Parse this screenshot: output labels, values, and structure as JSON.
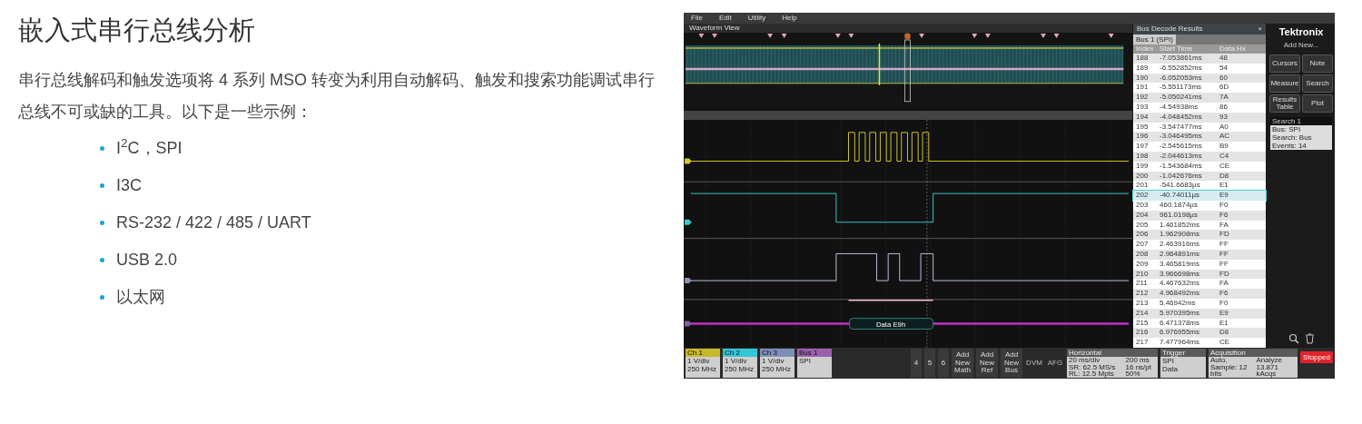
{
  "article": {
    "title": "嵌入式串行总线分析",
    "intro": "串行总线解码和触发选项将 4 系列 MSO 转变为利用自动解码、触发和搜索功能调试串行总线不可或缺的工具。以下是一些示例：",
    "items": [
      "I$^{2}$C，SPI",
      "I3C",
      "RS-232 / 422 / 485 / UART",
      "USB 2.0",
      "以太网"
    ]
  },
  "scope": {
    "menu": [
      "File",
      "Edit",
      "Utility",
      "Help"
    ],
    "waveform_view": {
      "title": "Waveform View",
      "decode_label": "Data E9h"
    },
    "results": {
      "title": "Bus Decode Results",
      "close": "×",
      "tab": "Bus 1 (SPI)",
      "columns": [
        "Index",
        "Start Time",
        "Data Hx"
      ],
      "rows": [
        {
          "index": "188",
          "start_time": "-7.053861ms",
          "data": "48",
          "selected": false
        },
        {
          "index": "189",
          "start_time": "-6.552852ms",
          "data": "54",
          "selected": false
        },
        {
          "index": "190",
          "start_time": "-6.052053ms",
          "data": "60",
          "selected": false
        },
        {
          "index": "191",
          "start_time": "-5.551173ms",
          "data": "6D",
          "selected": false
        },
        {
          "index": "192",
          "start_time": "-5.050241ms",
          "data": "7A",
          "selected": false
        },
        {
          "index": "193",
          "start_time": "-4.54938ms",
          "data": "86",
          "selected": false
        },
        {
          "index": "194",
          "start_time": "-4.048452ms",
          "data": "93",
          "selected": false
        },
        {
          "index": "195",
          "start_time": "-3.547477ms",
          "data": "A0",
          "selected": false
        },
        {
          "index": "196",
          "start_time": "-3.046495ms",
          "data": "AC",
          "selected": false
        },
        {
          "index": "197",
          "start_time": "-2.545615ms",
          "data": "B9",
          "selected": false
        },
        {
          "index": "198",
          "start_time": "-2.044613ms",
          "data": "C4",
          "selected": false
        },
        {
          "index": "199",
          "start_time": "-1.543684ms",
          "data": "CE",
          "selected": false
        },
        {
          "index": "200",
          "start_time": "-1.042676ms",
          "data": "D8",
          "selected": false
        },
        {
          "index": "201",
          "start_time": "-541.6683µs",
          "data": "E1",
          "selected": false
        },
        {
          "index": "202",
          "start_time": "-40.74011µs",
          "data": "E9",
          "selected": true
        },
        {
          "index": "203",
          "start_time": "460.1874µs",
          "data": "F0",
          "selected": false
        },
        {
          "index": "204",
          "start_time": "961.0198µs",
          "data": "F6",
          "selected": false
        },
        {
          "index": "205",
          "start_time": "1.461852ms",
          "data": "FA",
          "selected": false
        },
        {
          "index": "206",
          "start_time": "1.962908ms",
          "data": "FD",
          "selected": false
        },
        {
          "index": "207",
          "start_time": "2.463916ms",
          "data": "FF",
          "selected": false
        },
        {
          "index": "208",
          "start_time": "2.964891ms",
          "data": "FF",
          "selected": false
        },
        {
          "index": "209",
          "start_time": "3.465819ms",
          "data": "FF",
          "selected": false
        },
        {
          "index": "210",
          "start_time": "3.966698ms",
          "data": "FD",
          "selected": false
        },
        {
          "index": "211",
          "start_time": "4.467632ms",
          "data": "FA",
          "selected": false
        },
        {
          "index": "212",
          "start_time": "4.968492ms",
          "data": "F6",
          "selected": false
        },
        {
          "index": "213",
          "start_time": "5.46942ms",
          "data": "F0",
          "selected": false
        },
        {
          "index": "214",
          "start_time": "5.970395ms",
          "data": "E9",
          "selected": false
        },
        {
          "index": "215",
          "start_time": "6.471378ms",
          "data": "E1",
          "selected": false
        },
        {
          "index": "216",
          "start_time": "6.976955ms",
          "data": "D8",
          "selected": false
        },
        {
          "index": "217",
          "start_time": "7.477964ms",
          "data": "CE",
          "selected": false
        }
      ]
    },
    "sidebar": {
      "brand": "Tektronix",
      "add_new": "Add New...",
      "buttons": [
        "Cursors",
        "Note",
        "Measure",
        "Search",
        "Results Table",
        "Plot"
      ],
      "search": {
        "title": "Search 1",
        "lines": [
          "Bus: SPI",
          "Search: Bus",
          "Events: 14"
        ]
      }
    },
    "bottom": {
      "channels": [
        {
          "label": "Ch 1",
          "lines": [
            "1 V/div",
            "250 MHz"
          ],
          "color": "#c9b92a"
        },
        {
          "label": "Ch 2",
          "lines": [
            "1 V/div",
            "250 MHz"
          ],
          "color": "#34c6d6"
        },
        {
          "label": "Ch 3",
          "lines": [
            "1 V/div",
            "250 MHz"
          ],
          "color": "#7d8fb8"
        },
        {
          "label": "Bus 1",
          "lines": [
            "SPI"
          ],
          "color": "#9b5fae"
        }
      ],
      "numbers": [
        "4",
        "5",
        "6"
      ],
      "add_buttons": [
        "Add New Math",
        "Add New Ref",
        "Add New Bus"
      ],
      "tools": [
        "DVM",
        "AFG"
      ],
      "horizontal": {
        "title": "Horizontal",
        "lines": [
          "20 ms/div",
          "200 ms",
          "SR: 62.5 MS/s",
          "16 ns/pt",
          "RL: 12.5 Mpts",
          "50%"
        ]
      },
      "trigger": {
        "title": "Trigger",
        "lines": [
          "SPI",
          "Data"
        ]
      },
      "acquisition": {
        "title": "Acquisition",
        "lines": [
          "Auto,",
          "Analyze",
          "Sample: 12 bits",
          "13.871 kAcqs"
        ]
      },
      "run_state": "Stopped"
    }
  }
}
